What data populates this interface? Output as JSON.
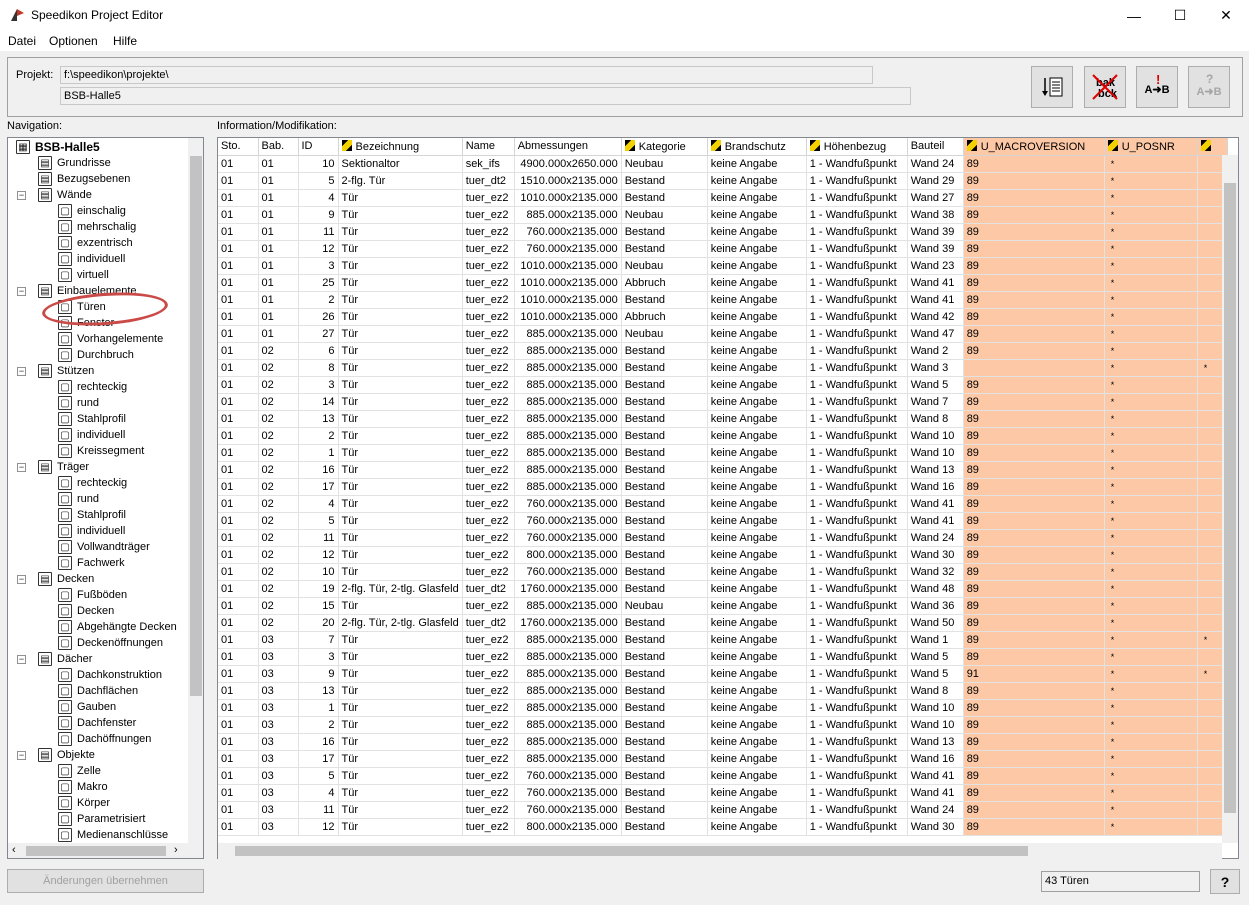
{
  "window": {
    "title": "Speedikon Project Editor",
    "minimize": "—",
    "maximize": "☐",
    "close": "✕"
  },
  "menu": [
    "Datei",
    "Optionen",
    "Hilfe"
  ],
  "project": {
    "label": "Projekt:",
    "path": "f:\\speedikon\\projekte\\",
    "name": "BSB-Halle5"
  },
  "toolbar": {
    "btn3": "A➜B",
    "btn4": "A➜B",
    "btn4_q": "?"
  },
  "nav": {
    "label": "Navigation:",
    "tree": [
      {
        "l": 0,
        "t": "BSB-Halle5",
        "i": "building-icon",
        "exp": "−",
        "bold": true
      },
      {
        "l": 1,
        "t": "Grundrisse",
        "i": "floorplan-icon"
      },
      {
        "l": 1,
        "t": "Bezugsebenen",
        "i": "levels-icon"
      },
      {
        "l": 1,
        "t": "Wände",
        "i": "wall-icon",
        "exp": "−"
      },
      {
        "l": 2,
        "t": "einschalig",
        "i": "wall-single-icon"
      },
      {
        "l": 2,
        "t": "mehrschalig",
        "i": "wall-multi-icon"
      },
      {
        "l": 2,
        "t": "exzentrisch",
        "i": "wall-eccentric-icon"
      },
      {
        "l": 2,
        "t": "individuell",
        "i": "wall-individual-icon"
      },
      {
        "l": 2,
        "t": "virtuell",
        "i": "wall-virtual-icon"
      },
      {
        "l": 1,
        "t": "Einbauelemente",
        "i": "elements-icon",
        "exp": "−"
      },
      {
        "l": 2,
        "t": "Türen",
        "i": "door-icon"
      },
      {
        "l": 2,
        "t": "Fenster",
        "i": "window-icon"
      },
      {
        "l": 2,
        "t": "Vorhangelemente",
        "i": "curtain-wall-icon"
      },
      {
        "l": 2,
        "t": "Durchbruch",
        "i": "opening-icon"
      },
      {
        "l": 1,
        "t": "Stützen",
        "i": "column-icon",
        "exp": "−"
      },
      {
        "l": 2,
        "t": "rechteckig",
        "i": "rect-icon"
      },
      {
        "l": 2,
        "t": "rund",
        "i": "round-icon"
      },
      {
        "l": 2,
        "t": "Stahlprofil",
        "i": "steel-profile-icon"
      },
      {
        "l": 2,
        "t": "individuell",
        "i": "individual-icon"
      },
      {
        "l": 2,
        "t": "Kreissegment",
        "i": "circle-segment-icon"
      },
      {
        "l": 1,
        "t": "Träger",
        "i": "beam-icon",
        "exp": "−"
      },
      {
        "l": 2,
        "t": "rechteckig",
        "i": "rect-icon"
      },
      {
        "l": 2,
        "t": "rund",
        "i": "round-icon"
      },
      {
        "l": 2,
        "t": "Stahlprofil",
        "i": "steel-profile-icon"
      },
      {
        "l": 2,
        "t": "individuell",
        "i": "individual-icon"
      },
      {
        "l": 2,
        "t": "Vollwandträger",
        "i": "plate-girder-icon"
      },
      {
        "l": 2,
        "t": "Fachwerk",
        "i": "truss-icon"
      },
      {
        "l": 1,
        "t": "Decken",
        "i": "slab-icon",
        "exp": "−"
      },
      {
        "l": 2,
        "t": "Fußböden",
        "i": "floor-icon"
      },
      {
        "l": 2,
        "t": "Decken",
        "i": "slab-icon"
      },
      {
        "l": 2,
        "t": "Abgehängte Decken",
        "i": "suspended-ceiling-icon"
      },
      {
        "l": 2,
        "t": "Deckenöffnungen",
        "i": "slab-opening-icon"
      },
      {
        "l": 1,
        "t": "Dächer",
        "i": "roof-icon",
        "exp": "−"
      },
      {
        "l": 2,
        "t": "Dachkonstruktion",
        "i": "roof-construction-icon"
      },
      {
        "l": 2,
        "t": "Dachflächen",
        "i": "roof-surface-icon"
      },
      {
        "l": 2,
        "t": "Gauben",
        "i": "dormer-icon"
      },
      {
        "l": 2,
        "t": "Dachfenster",
        "i": "roof-window-icon"
      },
      {
        "l": 2,
        "t": "Dachöffnungen",
        "i": "roof-opening-icon"
      },
      {
        "l": 1,
        "t": "Objekte",
        "i": "objects-icon",
        "exp": "−"
      },
      {
        "l": 2,
        "t": "Zelle",
        "i": "cell-icon"
      },
      {
        "l": 2,
        "t": "Makro",
        "i": "macro-icon"
      },
      {
        "l": 2,
        "t": "Körper",
        "i": "body-icon"
      },
      {
        "l": 2,
        "t": "Parametrisiert",
        "i": "parametric-icon"
      },
      {
        "l": 2,
        "t": "Medienanschlüsse",
        "i": "media-connection-icon"
      }
    ]
  },
  "info_label": "Information/Modifikation:",
  "columns": [
    {
      "t": "Sto.",
      "w": 40
    },
    {
      "t": "Bab.",
      "w": 40
    },
    {
      "t": "ID",
      "w": 40
    },
    {
      "t": "Bezeichnung",
      "w": 124,
      "pen": true
    },
    {
      "t": "Name",
      "w": 52
    },
    {
      "t": "Abmessungen",
      "w": 107
    },
    {
      "t": "Kategorie",
      "w": 86,
      "pen": true
    },
    {
      "t": "Brandschutz",
      "w": 99,
      "pen": true
    },
    {
      "t": "Höhenbezug",
      "w": 101,
      "pen": true
    },
    {
      "t": "Bauteil",
      "w": 56
    },
    {
      "t": "U_MACROVERSION",
      "w": 141,
      "pen": true,
      "hl": true
    },
    {
      "t": "U_POSNR",
      "w": 93,
      "pen": true,
      "hl": true
    },
    {
      "t": "",
      "w": 30,
      "pen": true,
      "hl": true
    }
  ],
  "rows": [
    [
      "01",
      "01",
      "10",
      "Sektionaltor",
      "sek_ifs",
      "4900.000x2650.000",
      "Neubau",
      "keine Angabe",
      "1 - Wandfußpunkt",
      "Wand 24",
      "89",
      "*",
      ""
    ],
    [
      "01",
      "01",
      "5",
      "2-flg. Tür",
      "tuer_dt2",
      "1510.000x2135.000",
      "Bestand",
      "keine Angabe",
      "1 - Wandfußpunkt",
      "Wand 29",
      "89",
      "*",
      ""
    ],
    [
      "01",
      "01",
      "4",
      "Tür",
      "tuer_ez2",
      "1010.000x2135.000",
      "Bestand",
      "keine Angabe",
      "1 - Wandfußpunkt",
      "Wand 27",
      "89",
      "*",
      ""
    ],
    [
      "01",
      "01",
      "9",
      "Tür",
      "tuer_ez2",
      "885.000x2135.000",
      "Neubau",
      "keine Angabe",
      "1 - Wandfußpunkt",
      "Wand 38",
      "89",
      "*",
      ""
    ],
    [
      "01",
      "01",
      "11",
      "Tür",
      "tuer_ez2",
      "760.000x2135.000",
      "Bestand",
      "keine Angabe",
      "1 - Wandfußpunkt",
      "Wand 39",
      "89",
      "*",
      ""
    ],
    [
      "01",
      "01",
      "12",
      "Tür",
      "tuer_ez2",
      "760.000x2135.000",
      "Bestand",
      "keine Angabe",
      "1 - Wandfußpunkt",
      "Wand 39",
      "89",
      "*",
      ""
    ],
    [
      "01",
      "01",
      "3",
      "Tür",
      "tuer_ez2",
      "1010.000x2135.000",
      "Neubau",
      "keine Angabe",
      "1 - Wandfußpunkt",
      "Wand 23",
      "89",
      "*",
      ""
    ],
    [
      "01",
      "01",
      "25",
      "Tür",
      "tuer_ez2",
      "1010.000x2135.000",
      "Abbruch",
      "keine Angabe",
      "1 - Wandfußpunkt",
      "Wand 41",
      "89",
      "*",
      ""
    ],
    [
      "01",
      "01",
      "2",
      "Tür",
      "tuer_ez2",
      "1010.000x2135.000",
      "Bestand",
      "keine Angabe",
      "1 - Wandfußpunkt",
      "Wand 41",
      "89",
      "*",
      ""
    ],
    [
      "01",
      "01",
      "26",
      "Tür",
      "tuer_ez2",
      "1010.000x2135.000",
      "Abbruch",
      "keine Angabe",
      "1 - Wandfußpunkt",
      "Wand 42",
      "89",
      "*",
      ""
    ],
    [
      "01",
      "01",
      "27",
      "Tür",
      "tuer_ez2",
      "885.000x2135.000",
      "Neubau",
      "keine Angabe",
      "1 - Wandfußpunkt",
      "Wand 47",
      "89",
      "*",
      ""
    ],
    [
      "01",
      "02",
      "6",
      "Tür",
      "tuer_ez2",
      "885.000x2135.000",
      "Bestand",
      "keine Angabe",
      "1 - Wandfußpunkt",
      "Wand 2",
      "89",
      "*",
      ""
    ],
    [
      "01",
      "02",
      "8",
      "Tür",
      "tuer_ez2",
      "885.000x2135.000",
      "Bestand",
      "keine Angabe",
      "1 - Wandfußpunkt",
      "Wand 3",
      "",
      "*",
      "*"
    ],
    [
      "01",
      "02",
      "3",
      "Tür",
      "tuer_ez2",
      "885.000x2135.000",
      "Bestand",
      "keine Angabe",
      "1 - Wandfußpunkt",
      "Wand 5",
      "89",
      "*",
      ""
    ],
    [
      "01",
      "02",
      "14",
      "Tür",
      "tuer_ez2",
      "885.000x2135.000",
      "Bestand",
      "keine Angabe",
      "1 - Wandfußpunkt",
      "Wand 7",
      "89",
      "*",
      ""
    ],
    [
      "01",
      "02",
      "13",
      "Tür",
      "tuer_ez2",
      "885.000x2135.000",
      "Bestand",
      "keine Angabe",
      "1 - Wandfußpunkt",
      "Wand 8",
      "89",
      "*",
      ""
    ],
    [
      "01",
      "02",
      "2",
      "Tür",
      "tuer_ez2",
      "885.000x2135.000",
      "Bestand",
      "keine Angabe",
      "1 - Wandfußpunkt",
      "Wand 10",
      "89",
      "*",
      ""
    ],
    [
      "01",
      "02",
      "1",
      "Tür",
      "tuer_ez2",
      "885.000x2135.000",
      "Bestand",
      "keine Angabe",
      "1 - Wandfußpunkt",
      "Wand 10",
      "89",
      "*",
      ""
    ],
    [
      "01",
      "02",
      "16",
      "Tür",
      "tuer_ez2",
      "885.000x2135.000",
      "Bestand",
      "keine Angabe",
      "1 - Wandfußpunkt",
      "Wand 13",
      "89",
      "*",
      ""
    ],
    [
      "01",
      "02",
      "17",
      "Tür",
      "tuer_ez2",
      "885.000x2135.000",
      "Bestand",
      "keine Angabe",
      "1 - Wandfußpunkt",
      "Wand 16",
      "89",
      "*",
      ""
    ],
    [
      "01",
      "02",
      "4",
      "Tür",
      "tuer_ez2",
      "760.000x2135.000",
      "Bestand",
      "keine Angabe",
      "1 - Wandfußpunkt",
      "Wand 41",
      "89",
      "*",
      ""
    ],
    [
      "01",
      "02",
      "5",
      "Tür",
      "tuer_ez2",
      "760.000x2135.000",
      "Bestand",
      "keine Angabe",
      "1 - Wandfußpunkt",
      "Wand 41",
      "89",
      "*",
      ""
    ],
    [
      "01",
      "02",
      "11",
      "Tür",
      "tuer_ez2",
      "760.000x2135.000",
      "Bestand",
      "keine Angabe",
      "1 - Wandfußpunkt",
      "Wand 24",
      "89",
      "*",
      ""
    ],
    [
      "01",
      "02",
      "12",
      "Tür",
      "tuer_ez2",
      "800.000x2135.000",
      "Bestand",
      "keine Angabe",
      "1 - Wandfußpunkt",
      "Wand 30",
      "89",
      "*",
      ""
    ],
    [
      "01",
      "02",
      "10",
      "Tür",
      "tuer_ez2",
      "760.000x2135.000",
      "Bestand",
      "keine Angabe",
      "1 - Wandfußpunkt",
      "Wand 32",
      "89",
      "*",
      ""
    ],
    [
      "01",
      "02",
      "19",
      "2-flg. Tür, 2-tlg. Glasfeld",
      "tuer_dt2",
      "1760.000x2135.000",
      "Bestand",
      "keine Angabe",
      "1 - Wandfußpunkt",
      "Wand 48",
      "89",
      "*",
      ""
    ],
    [
      "01",
      "02",
      "15",
      "Tür",
      "tuer_ez2",
      "885.000x2135.000",
      "Neubau",
      "keine Angabe",
      "1 - Wandfußpunkt",
      "Wand 36",
      "89",
      "*",
      ""
    ],
    [
      "01",
      "02",
      "20",
      "2-flg. Tür, 2-tlg. Glasfeld",
      "tuer_dt2",
      "1760.000x2135.000",
      "Bestand",
      "keine Angabe",
      "1 - Wandfußpunkt",
      "Wand 50",
      "89",
      "*",
      ""
    ],
    [
      "01",
      "03",
      "7",
      "Tür",
      "tuer_ez2",
      "885.000x2135.000",
      "Bestand",
      "keine Angabe",
      "1 - Wandfußpunkt",
      "Wand 1",
      "89",
      "*",
      "*"
    ],
    [
      "01",
      "03",
      "3",
      "Tür",
      "tuer_ez2",
      "885.000x2135.000",
      "Bestand",
      "keine Angabe",
      "1 - Wandfußpunkt",
      "Wand 5",
      "89",
      "*",
      ""
    ],
    [
      "01",
      "03",
      "9",
      "Tür",
      "tuer_ez2",
      "885.000x2135.000",
      "Bestand",
      "keine Angabe",
      "1 - Wandfußpunkt",
      "Wand 5",
      "91",
      "*",
      "*"
    ],
    [
      "01",
      "03",
      "13",
      "Tür",
      "tuer_ez2",
      "885.000x2135.000",
      "Bestand",
      "keine Angabe",
      "1 - Wandfußpunkt",
      "Wand 8",
      "89",
      "*",
      ""
    ],
    [
      "01",
      "03",
      "1",
      "Tür",
      "tuer_ez2",
      "885.000x2135.000",
      "Bestand",
      "keine Angabe",
      "1 - Wandfußpunkt",
      "Wand 10",
      "89",
      "*",
      ""
    ],
    [
      "01",
      "03",
      "2",
      "Tür",
      "tuer_ez2",
      "885.000x2135.000",
      "Bestand",
      "keine Angabe",
      "1 - Wandfußpunkt",
      "Wand 10",
      "89",
      "*",
      ""
    ],
    [
      "01",
      "03",
      "16",
      "Tür",
      "tuer_ez2",
      "885.000x2135.000",
      "Bestand",
      "keine Angabe",
      "1 - Wandfußpunkt",
      "Wand 13",
      "89",
      "*",
      ""
    ],
    [
      "01",
      "03",
      "17",
      "Tür",
      "tuer_ez2",
      "885.000x2135.000",
      "Bestand",
      "keine Angabe",
      "1 - Wandfußpunkt",
      "Wand 16",
      "89",
      "*",
      ""
    ],
    [
      "01",
      "03",
      "5",
      "Tür",
      "tuer_ez2",
      "760.000x2135.000",
      "Bestand",
      "keine Angabe",
      "1 - Wandfußpunkt",
      "Wand 41",
      "89",
      "*",
      ""
    ],
    [
      "01",
      "03",
      "4",
      "Tür",
      "tuer_ez2",
      "760.000x2135.000",
      "Bestand",
      "keine Angabe",
      "1 - Wandfußpunkt",
      "Wand 41",
      "89",
      "*",
      ""
    ],
    [
      "01",
      "03",
      "11",
      "Tür",
      "tuer_ez2",
      "760.000x2135.000",
      "Bestand",
      "keine Angabe",
      "1 - Wandfußpunkt",
      "Wand 24",
      "89",
      "*",
      ""
    ],
    [
      "01",
      "03",
      "12",
      "Tür",
      "tuer_ez2",
      "800.000x2135.000",
      "Bestand",
      "keine Angabe",
      "1 - Wandfußpunkt",
      "Wand 30",
      "89",
      "*",
      ""
    ]
  ],
  "footer": {
    "apply": "Änderungen übernehmen",
    "status": "43 Türen",
    "help": "?"
  },
  "colors": {
    "highlight": "#fcc8a6",
    "marker": "#c94a46"
  }
}
